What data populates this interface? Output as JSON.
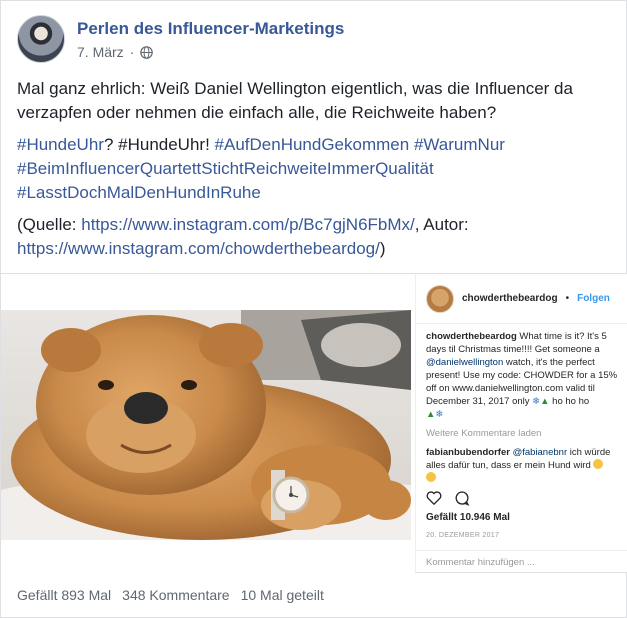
{
  "post": {
    "page_name": "Perlen des Influencer-Marketings",
    "date": "7. März",
    "privacy_icon": "globe-icon",
    "text_line1": "Mal ganz ehrlich: Weiß Daniel Wellington eigentlich, was die Influencer da verzapfen oder nehmen die einfach alle, die Reichweite haben?",
    "hashtags": {
      "h1": "#HundeUhr",
      "q": "? #HundeUhr!",
      "h2": "#AufDenHundGekommen",
      "h3": "#WarumNur",
      "h4": "#BeimInfluencerQuartettStichtReichweiteImmerQualität",
      "h5": "#LasstDochMalDenHundInRuhe"
    },
    "source": {
      "prefix": "(Quelle: ",
      "url1": "https://www.instagram.com/p/Bc7gjN6FbMx/",
      "middle": ", Autor:",
      "url2": "https://www.instagram.com/chowderthebeardog/",
      "suffix": ")"
    }
  },
  "instagram": {
    "username": "chowderthebeardog",
    "dot": "•",
    "follow": "Folgen",
    "caption_user": "chowderthebeardog",
    "caption_part1": " What time is it? It's 5 days til Christmas time!!!! Get someone a ",
    "caption_mention": "@danielwellington",
    "caption_part2": " watch, it's the perfect present! Use my code: CHOWDER for a 15% off on www.danielwellington.com valid til December 31, 2017 only",
    "caption_end": " ho ho ho",
    "more_comments": "Weitere Kommentare laden",
    "comment_user": "fabianbubendorfer",
    "comment_mention": "@fabianebnr",
    "comment_text": " ich würde alles dafür tun, dass er mein Hund wird",
    "likes": "Gefällt 10.946 Mal",
    "date": "20. DEZEMBER 2017",
    "comment_placeholder": "Kommentar hinzufügen ..."
  },
  "stats": {
    "likes": "Gefällt 893 Mal",
    "comments": "348 Kommentare",
    "shares": "10 Mal geteilt"
  },
  "colors": {
    "link": "#385898",
    "meta": "#606770",
    "instagram_blue": "#3897f0"
  }
}
